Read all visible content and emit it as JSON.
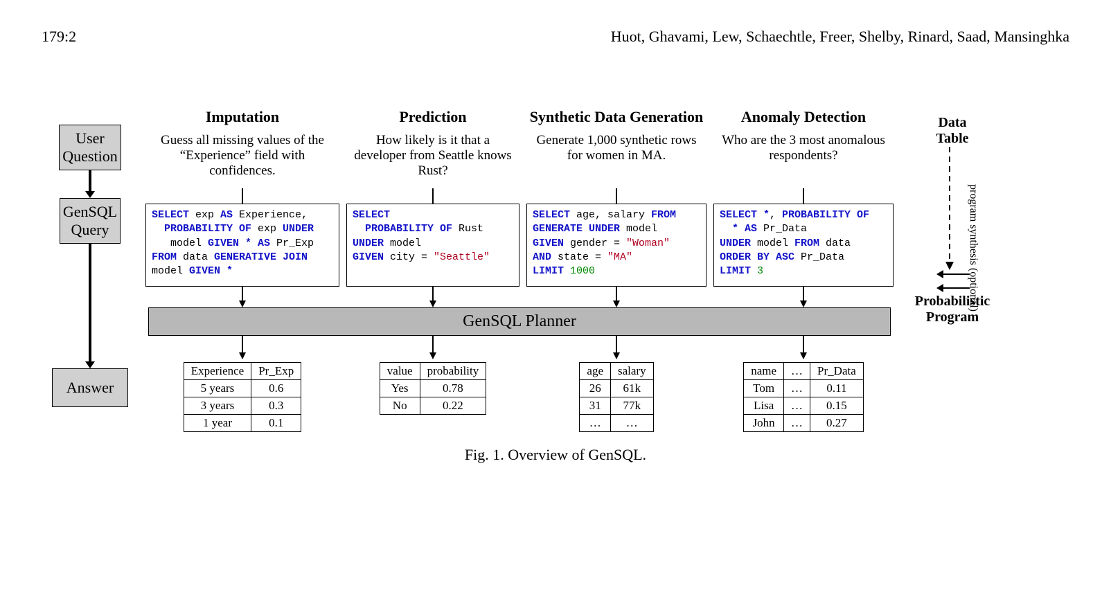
{
  "header": {
    "page_number": "179:2",
    "authors": "Huot, Ghavami, Lew, Schaechtle, Freer, Shelby, Rinard, Saad, Mansinghka"
  },
  "side": {
    "user_question": "User\nQuestion",
    "gensql_query": "GenSQL\nQuery",
    "answer": "Answer"
  },
  "right": {
    "data_table": "Data\nTable",
    "synthesis": "program synthesis (optional)",
    "prob_program": "Probabilistic\nProgram"
  },
  "planner": "GenSQL Planner",
  "caption": "Fig. 1.  Overview of GenSQL.",
  "cols": {
    "imputation": {
      "title": "Imputation",
      "question": "Guess all missing values of the “Experience” field with confidences.",
      "table": {
        "headers": [
          "Experience",
          "Pr_Exp"
        ],
        "rows": [
          [
            "5 years",
            "0.6"
          ],
          [
            "3 years",
            "0.3"
          ],
          [
            "1 year",
            "0.1"
          ]
        ]
      }
    },
    "prediction": {
      "title": "Prediction",
      "question": "How likely is it that a developer from Seattle knows Rust?",
      "table": {
        "headers": [
          "value",
          "probability"
        ],
        "rows": [
          [
            "Yes",
            "0.78"
          ],
          [
            "No",
            "0.22"
          ]
        ]
      }
    },
    "synthetic": {
      "title": "Synthetic Data Generation",
      "question": "Generate 1,000 synthetic rows for women in MA.",
      "table": {
        "headers": [
          "age",
          "salary"
        ],
        "rows": [
          [
            "26",
            "61k"
          ],
          [
            "31",
            "77k"
          ],
          [
            "…",
            "…"
          ]
        ]
      }
    },
    "anomaly": {
      "title": "Anomaly Detection",
      "question": "Who are the 3 most anomalous respondents?",
      "table": {
        "headers": [
          "name",
          "…",
          "Pr_Data"
        ],
        "rows": [
          [
            "Tom",
            "…",
            "0.11"
          ],
          [
            "Lisa",
            "…",
            "0.15"
          ],
          [
            "John",
            "…",
            "0.27"
          ]
        ]
      }
    }
  },
  "code": {
    "imputation": {
      "l1a": "SELECT",
      "l1b": " exp ",
      "l1c": "AS",
      "l1d": " Experience,",
      "l2a": "  PROBABILITY OF",
      "l2b": " exp ",
      "l2c": "UNDER",
      "l3a": "   model ",
      "l3b": "GIVEN * AS",
      "l3c": " Pr_Exp",
      "l4a": "FROM",
      "l4b": " data ",
      "l4c": "GENERATIVE JOIN",
      "l5a": "model ",
      "l5b": "GIVEN *"
    },
    "prediction": {
      "l1": "SELECT",
      "l2a": "  PROBABILITY OF",
      "l2b": " Rust",
      "l3a": "UNDER",
      "l3b": " model",
      "l4a": "GIVEN",
      "l4b": " city = ",
      "l4c": "\"Seattle\""
    },
    "synthetic": {
      "l1a": "SELECT",
      "l1b": " age, salary ",
      "l1c": "FROM",
      "l2a": "GENERATE UNDER",
      "l2b": " model",
      "l3a": "GIVEN",
      "l3b": " gender = ",
      "l3c": "\"Woman\"",
      "l4a": "AND",
      "l4b": " state = ",
      "l4c": "\"MA\"",
      "l5a": "LIMIT ",
      "l5b": "1000"
    },
    "anomaly": {
      "l1a": "SELECT *",
      "l1b": ", ",
      "l1c": "PROBABILITY OF",
      "l2a": "  * AS",
      "l2b": " Pr_Data",
      "l3a": "UNDER",
      "l3b": " model ",
      "l3c": "FROM",
      "l3d": " data",
      "l4a": "ORDER BY ASC",
      "l4b": " Pr_Data",
      "l5a": "LIMIT ",
      "l5b": "3"
    }
  }
}
